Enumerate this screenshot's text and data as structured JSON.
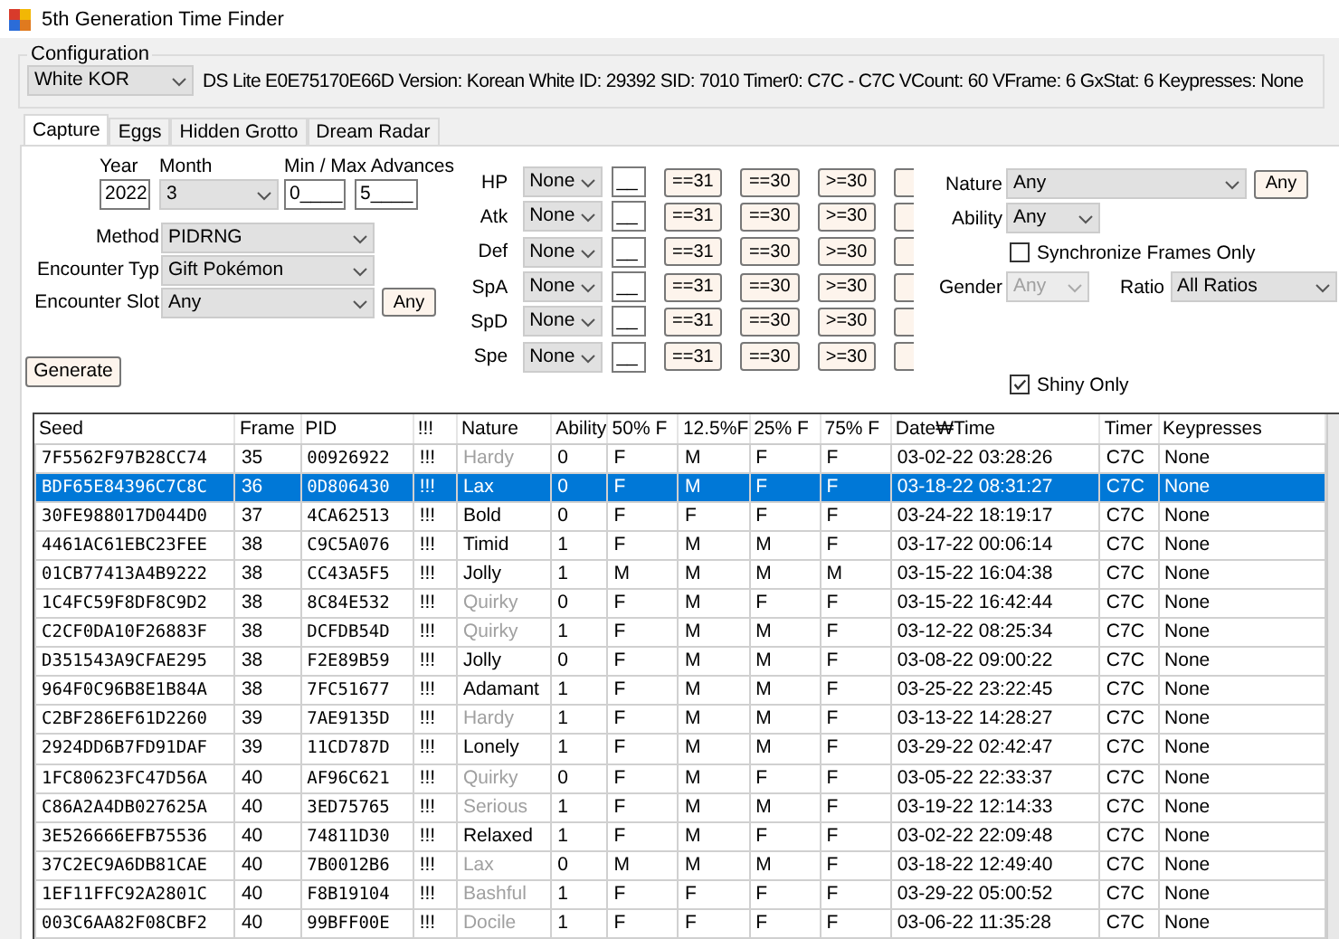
{
  "window": {
    "title": "5th Generation Time Finder"
  },
  "configuration": {
    "label": "Configuration",
    "profile": "White KOR",
    "info": "DS Lite E0E75170E66D Version: Korean White ID: 29392 SID: 7010 Timer0: C7C - C7C VCount: 60 VFrame: 6 GxStat: 6 Keypresses: None"
  },
  "tabs": [
    {
      "label": "Capture",
      "selected": true
    },
    {
      "label": "Eggs",
      "selected": false
    },
    {
      "label": "Hidden Grotto",
      "selected": false
    },
    {
      "label": "Dream Radar",
      "selected": false
    }
  ],
  "search": {
    "year_label": "Year",
    "year": "2022",
    "month_label": "Month",
    "month": "3",
    "advances_label": "Min / Max Advances",
    "min_advances": "0____",
    "max_advances": "5____",
    "method_label": "Method",
    "method": "PIDRNG",
    "encounter_type_label": "Encounter Typ",
    "encounter_type": "Gift Pokémon",
    "encounter_slot_label": "Encounter Slot",
    "encounter_slot": "Any",
    "slot_any_button": "Any",
    "generate_button": "Generate"
  },
  "ivs": [
    {
      "stat": "HP",
      "filter": "None",
      "value": "__",
      "buttons": [
        "==31",
        "==30",
        ">=30"
      ]
    },
    {
      "stat": "Atk",
      "filter": "None",
      "value": "__",
      "buttons": [
        "==31",
        "==30",
        ">=30"
      ]
    },
    {
      "stat": "Def",
      "filter": "None",
      "value": "__",
      "buttons": [
        "==31",
        "==30",
        ">=30"
      ]
    },
    {
      "stat": "SpA",
      "filter": "None",
      "value": "__",
      "buttons": [
        "==31",
        "==30",
        ">=30"
      ]
    },
    {
      "stat": "SpD",
      "filter": "None",
      "value": "__",
      "buttons": [
        "==31",
        "==30",
        ">=30"
      ]
    },
    {
      "stat": "Spe",
      "filter": "None",
      "value": "__",
      "buttons": [
        "==31",
        "==30",
        ">=30"
      ]
    }
  ],
  "filters": {
    "nature_label": "Nature",
    "nature": "Any",
    "nature_any_button": "Any",
    "ability_label": "Ability",
    "ability": "Any",
    "synchronize": {
      "label": "Synchronize Frames Only",
      "checked": false
    },
    "gender_label": "Gender",
    "gender": "Any",
    "gender_disabled": true,
    "ratio_label": "Ratio",
    "ratio": "All Ratios",
    "shiny": {
      "label": "Shiny Only",
      "checked": true
    }
  },
  "table": {
    "columns": [
      "Seed",
      "Frame",
      "PID",
      "!!!",
      "Nature",
      "Ability",
      "50% F",
      "12.5%F",
      "25% F",
      "75% F",
      "Date₩Time",
      "Timer",
      "Keypresses"
    ],
    "rows": [
      {
        "cells": [
          "7F5562F97B28CC74",
          "35",
          "00926922",
          "!!!",
          "Hardy",
          "0",
          "F",
          "M",
          "F",
          "F",
          "03-02-22 03:28:26",
          "C7C",
          "None"
        ],
        "selected": false,
        "nature_dimmed": true
      },
      {
        "cells": [
          "BDF65E84396C7C8C",
          "36",
          "0D806430",
          "!!!",
          "Lax",
          "0",
          "F",
          "M",
          "F",
          "F",
          "03-18-22 08:31:27",
          "C7C",
          "None"
        ],
        "selected": true,
        "nature_dimmed": false
      },
      {
        "cells": [
          "30FE988017D044D0",
          "37",
          "4CA62513",
          "!!!",
          "Bold",
          "0",
          "F",
          "F",
          "F",
          "F",
          "03-24-22 18:19:17",
          "C7C",
          "None"
        ],
        "selected": false,
        "nature_dimmed": false
      },
      {
        "cells": [
          "4461AC61EBC23FEE",
          "38",
          "C9C5A076",
          "!!!",
          "Timid",
          "1",
          "F",
          "M",
          "M",
          "F",
          "03-17-22 00:06:14",
          "C7C",
          "None"
        ],
        "selected": false,
        "nature_dimmed": false
      },
      {
        "cells": [
          "01CB77413A4B9222",
          "38",
          "CC43A5F5",
          "!!!",
          "Jolly",
          "1",
          "M",
          "M",
          "M",
          "M",
          "03-15-22 16:04:38",
          "C7C",
          "None"
        ],
        "selected": false,
        "nature_dimmed": false
      },
      {
        "cells": [
          "1C4FC59F8DF8C9D2",
          "38",
          "8C84E532",
          "!!!",
          "Quirky",
          "0",
          "F",
          "M",
          "F",
          "F",
          "03-15-22 16:42:44",
          "C7C",
          "None"
        ],
        "selected": false,
        "nature_dimmed": true
      },
      {
        "cells": [
          "C2CF0DA10F26883F",
          "38",
          "DCFDB54D",
          "!!!",
          "Quirky",
          "1",
          "F",
          "M",
          "M",
          "F",
          "03-12-22 08:25:34",
          "C7C",
          "None"
        ],
        "selected": false,
        "nature_dimmed": true
      },
      {
        "cells": [
          "D351543A9CFAE295",
          "38",
          "F2E89B59",
          "!!!",
          "Jolly",
          "0",
          "F",
          "M",
          "M",
          "F",
          "03-08-22 09:00:22",
          "C7C",
          "None"
        ],
        "selected": false,
        "nature_dimmed": false
      },
      {
        "cells": [
          "964F0C96B8E1B84A",
          "38",
          "7FC51677",
          "!!!",
          "Adamant",
          "1",
          "F",
          "M",
          "M",
          "F",
          "03-25-22 23:22:45",
          "C7C",
          "None"
        ],
        "selected": false,
        "nature_dimmed": false
      },
      {
        "cells": [
          "C2BF286EF61D2260",
          "39",
          "7AE9135D",
          "!!!",
          "Hardy",
          "1",
          "F",
          "M",
          "M",
          "F",
          "03-13-22 14:28:27",
          "C7C",
          "None"
        ],
        "selected": false,
        "nature_dimmed": true
      },
      {
        "cells": [
          "2924DD6B7FD91DAF",
          "39",
          "11CD787D",
          "!!!",
          "Lonely",
          "1",
          "F",
          "M",
          "M",
          "F",
          "03-29-22 02:42:47",
          "C7C",
          "None"
        ],
        "selected": false,
        "nature_dimmed": false
      },
      {
        "cells": [
          "1FC80623FC47D56A",
          "40",
          "AF96C621",
          "!!!",
          "Quirky",
          "0",
          "F",
          "M",
          "F",
          "F",
          "03-05-22 22:33:37",
          "C7C",
          "None"
        ],
        "selected": false,
        "nature_dimmed": true
      },
      {
        "cells": [
          "C86A2A4DB027625A",
          "40",
          "3ED75765",
          "!!!",
          "Serious",
          "1",
          "F",
          "M",
          "M",
          "F",
          "03-19-22 12:14:33",
          "C7C",
          "None"
        ],
        "selected": false,
        "nature_dimmed": true
      },
      {
        "cells": [
          "3E526666EFB75536",
          "40",
          "74811D30",
          "!!!",
          "Relaxed",
          "1",
          "F",
          "M",
          "F",
          "F",
          "03-02-22 22:09:48",
          "C7C",
          "None"
        ],
        "selected": false,
        "nature_dimmed": false
      },
      {
        "cells": [
          "37C2EC9A6DB81CAE",
          "40",
          "7B0012B6",
          "!!!",
          "Lax",
          "0",
          "M",
          "M",
          "M",
          "F",
          "03-18-22 12:49:40",
          "C7C",
          "None"
        ],
        "selected": false,
        "nature_dimmed": true
      },
      {
        "cells": [
          "1EF11FFC92A2801C",
          "40",
          "F8B19104",
          "!!!",
          "Bashful",
          "1",
          "F",
          "F",
          "F",
          "F",
          "03-29-22 05:00:52",
          "C7C",
          "None"
        ],
        "selected": false,
        "nature_dimmed": true
      },
      {
        "cells": [
          "003C6AA82F08CBF2",
          "40",
          "99BFF00E",
          "!!!",
          "Docile",
          "1",
          "F",
          "F",
          "F",
          "F",
          "03-06-22 11:35:28",
          "C7C",
          "None"
        ],
        "selected": false,
        "nature_dimmed": true
      }
    ]
  }
}
